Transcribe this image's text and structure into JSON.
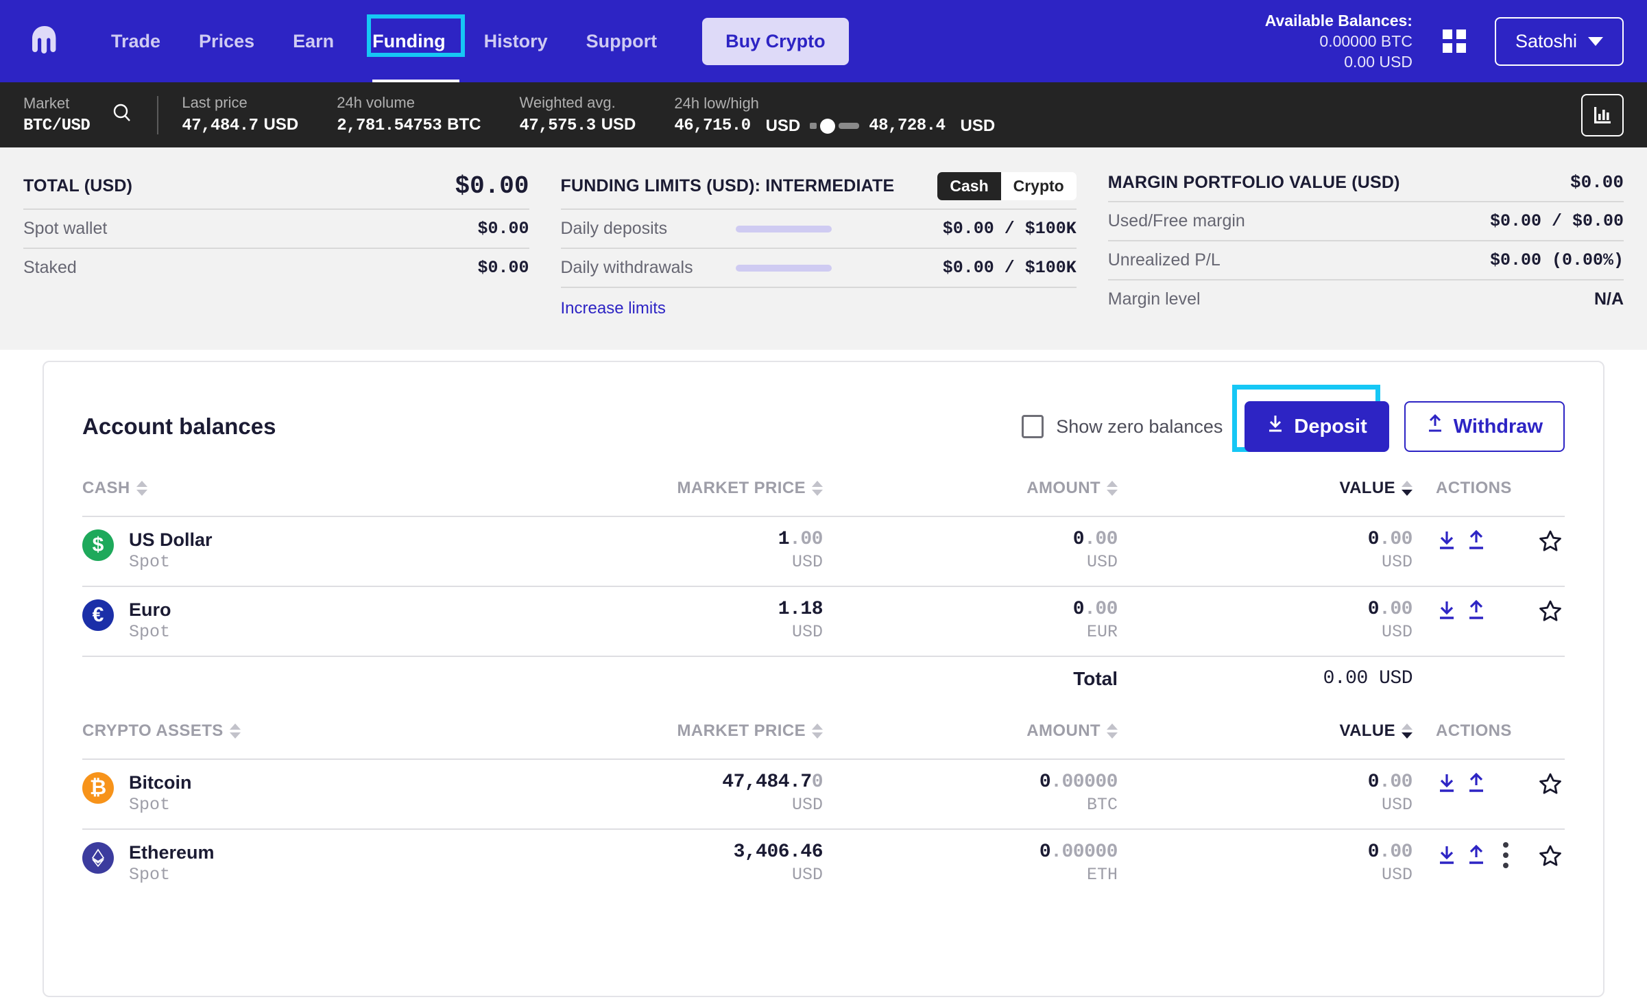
{
  "nav": {
    "logo_icon": "kraken-logo-icon",
    "items": [
      {
        "label": "Trade",
        "active": false
      },
      {
        "label": "Prices",
        "active": false
      },
      {
        "label": "Earn",
        "active": false
      },
      {
        "label": "Funding",
        "active": true
      },
      {
        "label": "History",
        "active": false
      },
      {
        "label": "Support",
        "active": false
      }
    ],
    "buy_crypto": "Buy Crypto",
    "balances_title": "Available Balances:",
    "balance_btc": "0.00000 BTC",
    "balance_usd": "0.00 USD",
    "grid_icon": "apps-grid-icon",
    "user": "Satoshi"
  },
  "market_bar": {
    "market_label": "Market",
    "market_value": "BTC/USD",
    "search_icon": "search-icon",
    "chart_icon": "bar-chart-icon",
    "stats": [
      {
        "label": "Last price",
        "value": "47,484.7",
        "unit": "USD"
      },
      {
        "label": "24h volume",
        "value": "2,781.54753",
        "unit": "BTC"
      },
      {
        "label": "Weighted avg.",
        "value": "47,575.3",
        "unit": "USD"
      }
    ],
    "lowhigh": {
      "label": "24h low/high",
      "low": "46,715.0",
      "low_unit": "USD",
      "high": "48,728.4",
      "high_unit": "USD"
    }
  },
  "summary": {
    "total": {
      "title": "TOTAL (USD)",
      "amount": "$0.00",
      "rows": [
        {
          "label": "Spot wallet",
          "value": "$0.00"
        },
        {
          "label": "Staked",
          "value": "$0.00"
        }
      ]
    },
    "limits": {
      "title": "FUNDING LIMITS (USD): INTERMEDIATE",
      "toggle_on": "Cash",
      "toggle_off": "Crypto",
      "rows": [
        {
          "label": "Daily deposits",
          "value": "$0.00  /  $100K"
        },
        {
          "label": "Daily withdrawals",
          "value": "$0.00  /  $100K"
        }
      ],
      "link": "Increase limits"
    },
    "margin": {
      "title": "MARGIN PORTFOLIO VALUE (USD)",
      "amount": "$0.00",
      "rows": [
        {
          "label": "Used/Free margin",
          "value": "$0.00  /  $0.00"
        },
        {
          "label": "Unrealized P/L",
          "value": "$0.00  (0.00%)"
        },
        {
          "label": "Margin level",
          "value": "N/A"
        }
      ]
    }
  },
  "balances_card": {
    "title": "Account balances",
    "show_zero_label": "Show zero balances",
    "deposit_label": "Deposit",
    "withdraw_label": "Withdraw",
    "deposit_icon": "download-arrow-icon",
    "withdraw_icon": "upload-arrow-icon",
    "cash_table": {
      "headers": {
        "asset": "CASH",
        "market_price": "MARKET PRICE",
        "amount": "AMOUNT",
        "value": "VALUE",
        "actions": "ACTIONS"
      },
      "sorted_column": "VALUE",
      "sort_direction": "desc",
      "rows": [
        {
          "icon": "us-dollar-coin-icon",
          "symbol": "$",
          "name": "US Dollar",
          "sub": "Spot",
          "price_main": "1",
          "price_dim": ".00",
          "price_unit": "USD",
          "amount_main": "0",
          "amount_dim": ".00",
          "amount_unit": "USD",
          "value_main": "0",
          "value_dim": ".00",
          "value_unit": "USD",
          "has_menu": false
        },
        {
          "icon": "euro-coin-icon",
          "symbol": "€",
          "name": "Euro",
          "sub": "Spot",
          "price_main": "1.18",
          "price_dim": "",
          "price_unit": "USD",
          "amount_main": "0",
          "amount_dim": ".00",
          "amount_unit": "EUR",
          "value_main": "0",
          "value_dim": ".00",
          "value_unit": "USD",
          "has_menu": false
        }
      ],
      "total_label": "Total",
      "total_value": "0.00 USD"
    },
    "crypto_table": {
      "headers": {
        "asset": "CRYPTO ASSETS",
        "market_price": "MARKET PRICE",
        "amount": "AMOUNT",
        "value": "VALUE",
        "actions": "ACTIONS"
      },
      "sorted_column": "VALUE",
      "sort_direction": "desc",
      "rows": [
        {
          "icon": "bitcoin-coin-icon",
          "symbol": "₿",
          "name": "Bitcoin",
          "sub": "Spot",
          "price_main": "47,484.7",
          "price_dim": "0",
          "price_unit": "USD",
          "amount_main": "0",
          "amount_dim": ".00000",
          "amount_unit": "BTC",
          "value_main": "0",
          "value_dim": ".00",
          "value_unit": "USD",
          "has_menu": false
        },
        {
          "icon": "ethereum-coin-icon",
          "symbol": "◆",
          "name": "Ethereum",
          "sub": "Spot",
          "price_main": "3,406.46",
          "price_dim": "",
          "price_unit": "USD",
          "amount_main": "0",
          "amount_dim": ".00000",
          "amount_unit": "ETH",
          "value_main": "0",
          "value_dim": ".00",
          "value_unit": "USD",
          "has_menu": true
        }
      ]
    },
    "row_action_icons": {
      "deposit": "download-arrow-icon",
      "withdraw": "upload-arrow-icon",
      "more": "more-vertical-icon",
      "favorite": "star-outline-icon"
    }
  },
  "colors": {
    "brand_blue": "#2D24C4",
    "highlight_cyan": "#16C7F5",
    "market_bar_bg": "#242424",
    "usd_green": "#1EA95B",
    "btc_orange": "#F7931A",
    "eth_indigo": "#3C3C9E"
  }
}
